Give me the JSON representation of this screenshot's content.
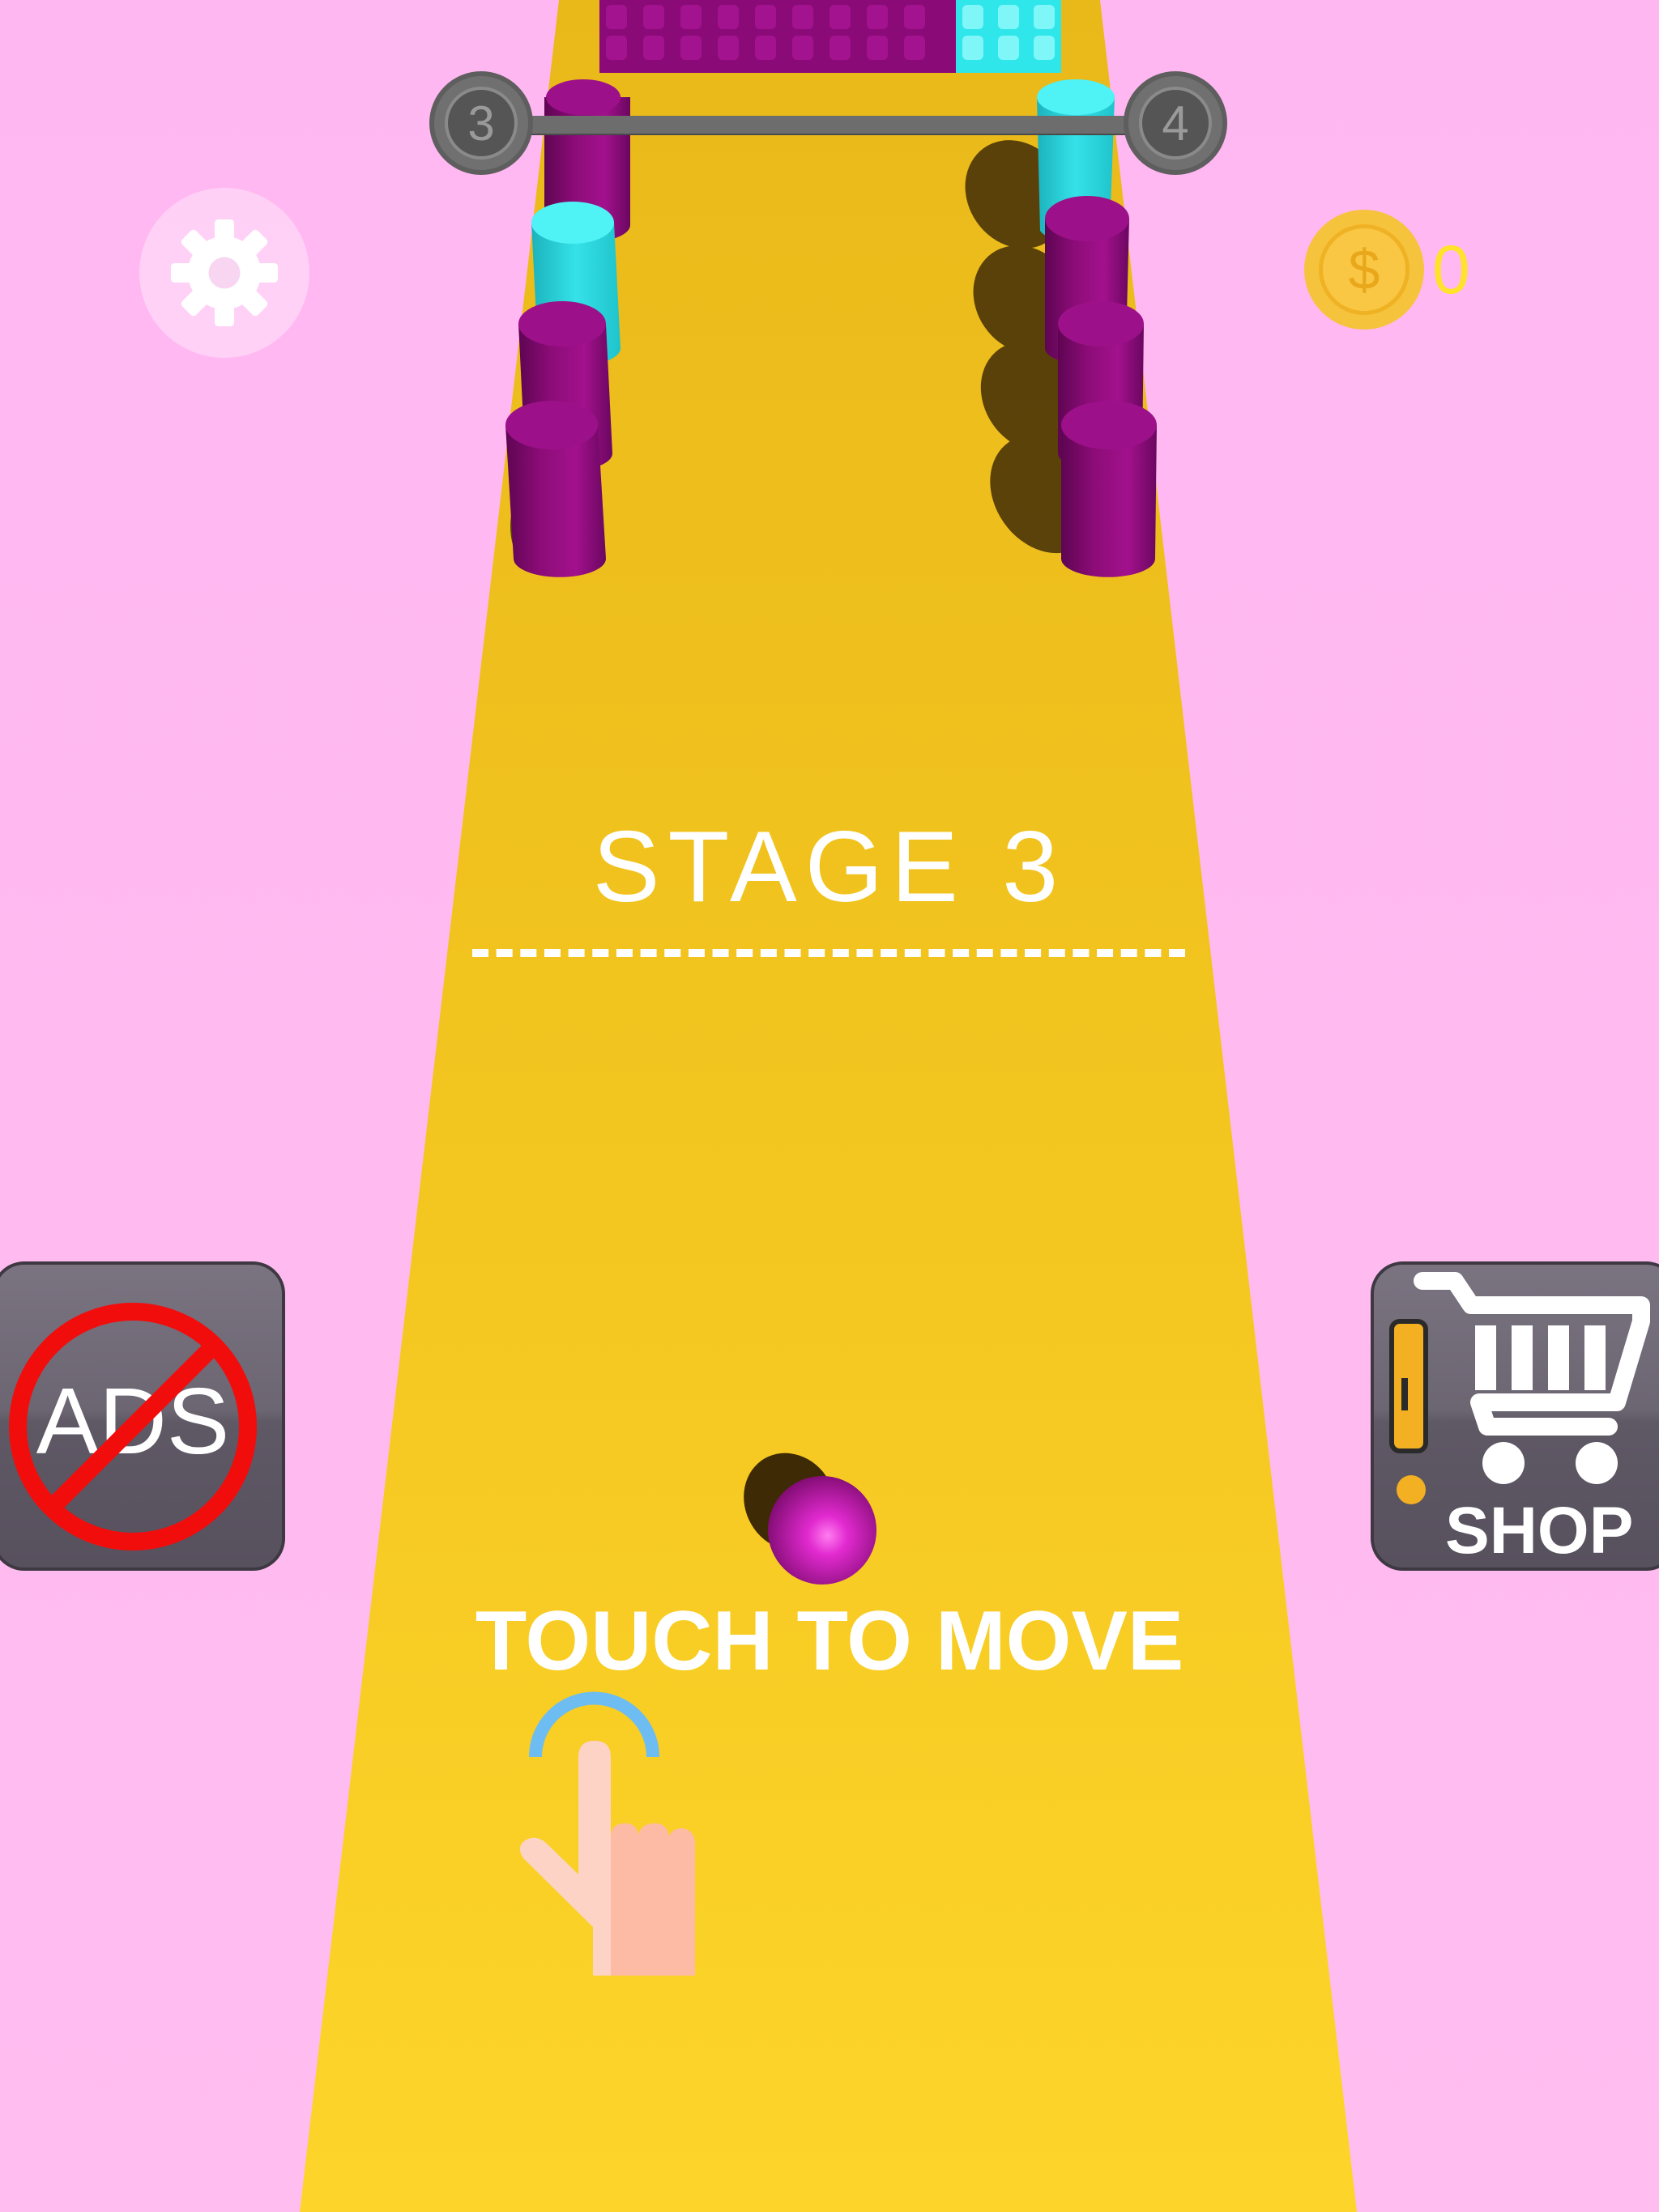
{
  "hud": {
    "current_level": "3",
    "next_level": "4",
    "coins": "0"
  },
  "stage": {
    "title": "STAGE 3"
  },
  "buttons": {
    "no_ads_label": "ADS",
    "shop_label": "SHOP"
  },
  "hint": {
    "text": "TOUCH TO MOVE"
  },
  "colors": {
    "background": "#ffbaf0",
    "track": "#f5c422",
    "pillar_purple": "#9b0f86",
    "pillar_cyan": "#2fe6ea",
    "ball": "#d21cc0"
  },
  "icons": [
    "gear-icon",
    "coin-icon",
    "no-sign-icon",
    "shopping-cart-icon",
    "tap-hand-icon"
  ]
}
